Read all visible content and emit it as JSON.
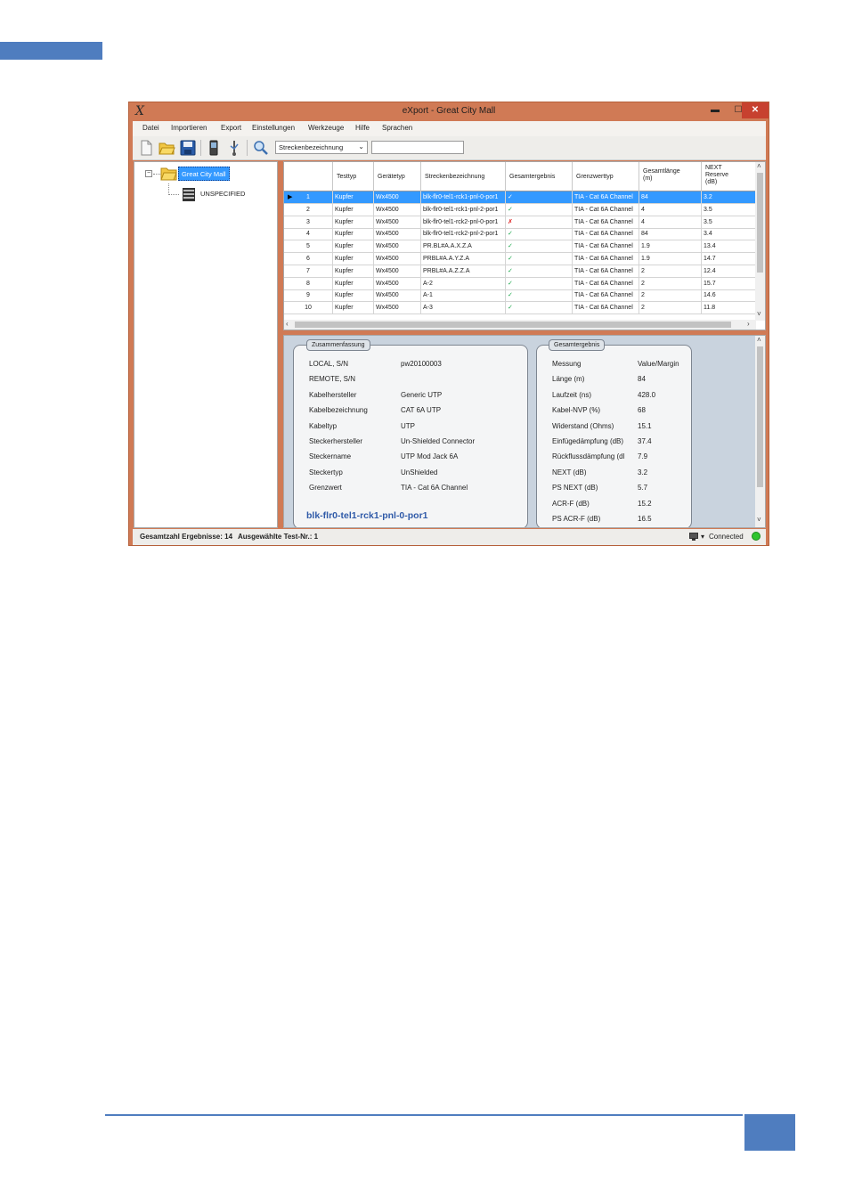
{
  "window": {
    "title": "eXport - Great City Mall",
    "app_icon": "X",
    "min_glyph": "▬",
    "max_glyph": "☐",
    "close_glyph": "✕"
  },
  "menu": [
    "Datei",
    "Importieren",
    "Export",
    "Einstellungen",
    "Werkzeuge",
    "Hilfe",
    "Sprachen"
  ],
  "toolbar": {
    "icons": [
      "new-file-icon",
      "open-folder-icon",
      "save-icon",
      "device-icon",
      "usb-icon",
      "search-icon"
    ],
    "search_field_select": "Streckenbezeichnung",
    "search_value": ""
  },
  "tree": {
    "root": "Great City Mall",
    "child": "UNSPECIFIED",
    "expander": "−"
  },
  "grid": {
    "headers": [
      "Testtyp",
      "Gerätetyp",
      "Streckenbezeichnung",
      "Gesamtergebnis",
      "Grenzwerttyp",
      "Gesamtlänge (m)",
      "NEXT Reserve (dB)"
    ],
    "selected_marker": "▶",
    "rows": [
      {
        "n": "1",
        "typ": "Kupfer",
        "geraet": "Wx4500",
        "name": "blk-flr0-tel1-rck1-pnl-0-por1",
        "res": "✓",
        "pass": true,
        "grenz": "TIA - Cat 6A Channel",
        "len": "84",
        "next": "3.2"
      },
      {
        "n": "2",
        "typ": "Kupfer",
        "geraet": "Wx4500",
        "name": "blk-flr0-tel1-rck1-pnl-2-por1",
        "res": "✓",
        "pass": true,
        "grenz": "TIA - Cat 6A Channel",
        "len": "4",
        "next": "3.5"
      },
      {
        "n": "3",
        "typ": "Kupfer",
        "geraet": "Wx4500",
        "name": "blk-flr0-tel1-rck2-pnl-0-por1",
        "res": "✗",
        "pass": false,
        "grenz": "TIA - Cat 6A Channel",
        "len": "4",
        "next": "3.5"
      },
      {
        "n": "4",
        "typ": "Kupfer",
        "geraet": "Wx4500",
        "name": "blk-flr0-tel1-rck2-pnl-2-por1",
        "res": "✓",
        "pass": true,
        "grenz": "TIA - Cat 6A Channel",
        "len": "84",
        "next": "3.4"
      },
      {
        "n": "5",
        "typ": "Kupfer",
        "geraet": "Wx4500",
        "name": "PR.BL#A.A.X.Z.A",
        "res": "✓",
        "pass": true,
        "grenz": "TIA - Cat 6A Channel",
        "len": "1.9",
        "next": "13.4"
      },
      {
        "n": "6",
        "typ": "Kupfer",
        "geraet": "Wx4500",
        "name": "PRBL#A.A.Y.Z.A",
        "res": "✓",
        "pass": true,
        "grenz": "TIA - Cat 6A Channel",
        "len": "1.9",
        "next": "14.7"
      },
      {
        "n": "7",
        "typ": "Kupfer",
        "geraet": "Wx4500",
        "name": "PRBL#A.A.Z.Z.A",
        "res": "✓",
        "pass": true,
        "grenz": "TIA - Cat 6A Channel",
        "len": "2",
        "next": "12.4"
      },
      {
        "n": "8",
        "typ": "Kupfer",
        "geraet": "Wx4500",
        "name": "A-2",
        "res": "✓",
        "pass": true,
        "grenz": "TIA - Cat 6A Channel",
        "len": "2",
        "next": "15.7"
      },
      {
        "n": "9",
        "typ": "Kupfer",
        "geraet": "Wx4500",
        "name": "A-1",
        "res": "✓",
        "pass": true,
        "grenz": "TIA - Cat 6A Channel",
        "len": "2",
        "next": "14.6"
      },
      {
        "n": "10",
        "typ": "Kupfer",
        "geraet": "Wx4500",
        "name": "A-3",
        "res": "✓",
        "pass": true,
        "grenz": "TIA - Cat 6A Channel",
        "len": "2",
        "next": "11.8"
      }
    ]
  },
  "summary": {
    "title": "Zusammenfassung",
    "fields": [
      {
        "k": "LOCAL, S/N",
        "v": "pw20100003"
      },
      {
        "k": "REMOTE, S/N",
        "v": ""
      },
      {
        "k": "Kabelhersteller",
        "v": "Generic UTP"
      },
      {
        "k": "Kabelbezeichnung",
        "v": "CAT 6A UTP"
      },
      {
        "k": "Kabeltyp",
        "v": "UTP"
      },
      {
        "k": "Steckerhersteller",
        "v": "Un-Shielded Connector"
      },
      {
        "k": "Steckername",
        "v": "UTP Mod Jack 6A"
      },
      {
        "k": "Steckertyp",
        "v": "UnShielded"
      },
      {
        "k": "Grenzwert",
        "v": "TIA - Cat 6A Channel"
      }
    ],
    "link": "blk-flr0-tel1-rck1-pnl-0-por1"
  },
  "result": {
    "title": "Gesamtergebnis",
    "header": {
      "k": "Messung",
      "v": "Value/Margin"
    },
    "fields": [
      {
        "k": "Länge (m)",
        "v": "84"
      },
      {
        "k": "Laufzeit (ns)",
        "v": "428.0"
      },
      {
        "k": "Kabel-NVP (%)",
        "v": "68"
      },
      {
        "k": "Widerstand (Ohms)",
        "v": "15.1"
      },
      {
        "k": "Einfügedämpfung (dB)",
        "v": "37.4"
      },
      {
        "k": "Rückflussdämpfung (dl",
        "v": "7.9"
      },
      {
        "k": "NEXT (dB)",
        "v": "3.2"
      },
      {
        "k": "PS NEXT (dB)",
        "v": "5.7"
      },
      {
        "k": "ACR-F (dB)",
        "v": "15.2"
      },
      {
        "k": "PS ACR-F (dB)",
        "v": "16.5"
      }
    ]
  },
  "status": {
    "total": "Gesamtzahl Ergebnisse: 14",
    "selected": "Ausgewählte Test-Nr.: 1",
    "connection": "Connected",
    "connection_color": "#2ec52e"
  }
}
